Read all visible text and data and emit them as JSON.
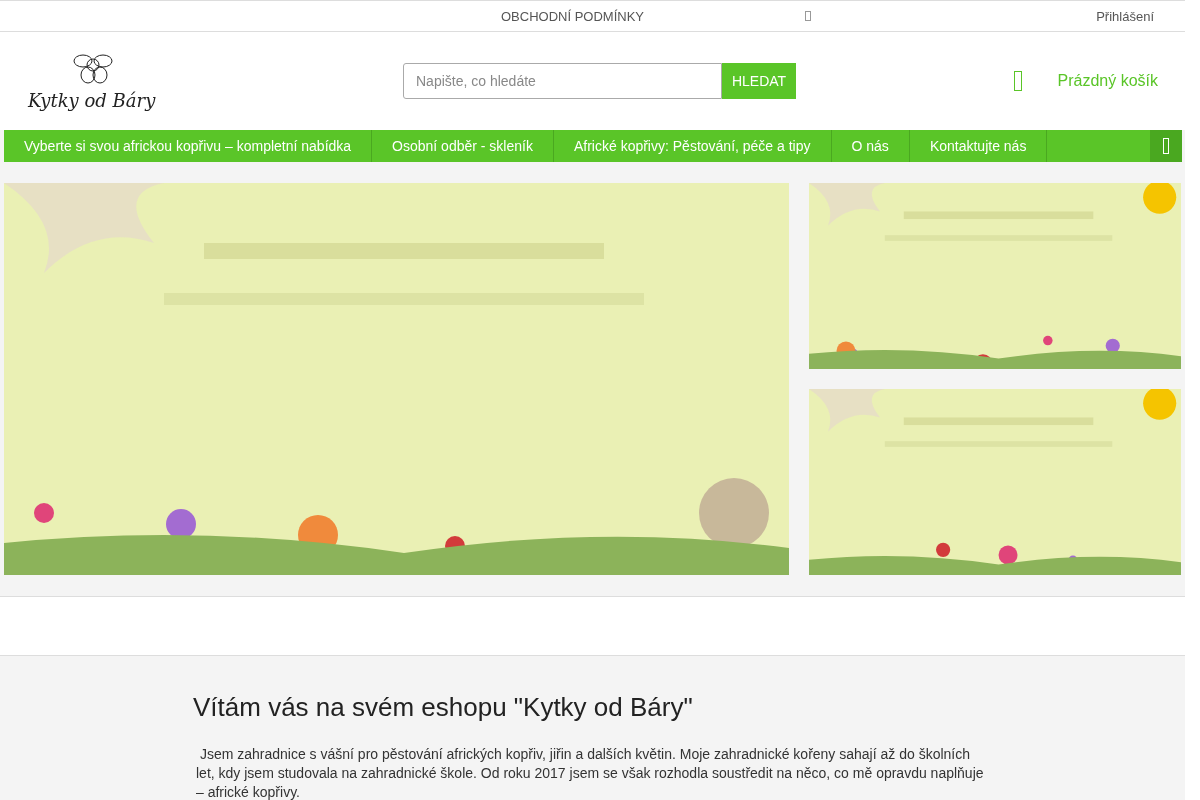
{
  "top_bar": {
    "terms_link": "OBCHODNÍ PODMÍNKY",
    "login_link": "Přihlášení"
  },
  "header": {
    "logo": "Kytky od Báry",
    "search": {
      "placeholder": "Napište, co hledáte",
      "button": "HLEDAT"
    },
    "cart": "Prázdný košík"
  },
  "nav": {
    "items": [
      {
        "label": "Vyberte si svou africkou kopřivu – kompletní nabídka"
      },
      {
        "label": "Osobní odběr - skleník"
      },
      {
        "label": "Africké kopřivy: Pěstování, péče a tipy"
      },
      {
        "label": "O nás"
      },
      {
        "label": "Kontaktujte nás"
      }
    ]
  },
  "welcome": {
    "title": "Vítám vás na svém eshopu \"Kytky od Báry\"",
    "text": " Jsem zahradnice s vášní pro pěstování afrických kopřiv, jiřin a dalších květin. Moje zahradnické kořeny sahají až do školních let, kdy jsem studovala na zahradnické škole. Od roku 2017 jsem se však rozhodla soustředit na něco, co mě opravdu naplňuje – africké kopřivy."
  }
}
